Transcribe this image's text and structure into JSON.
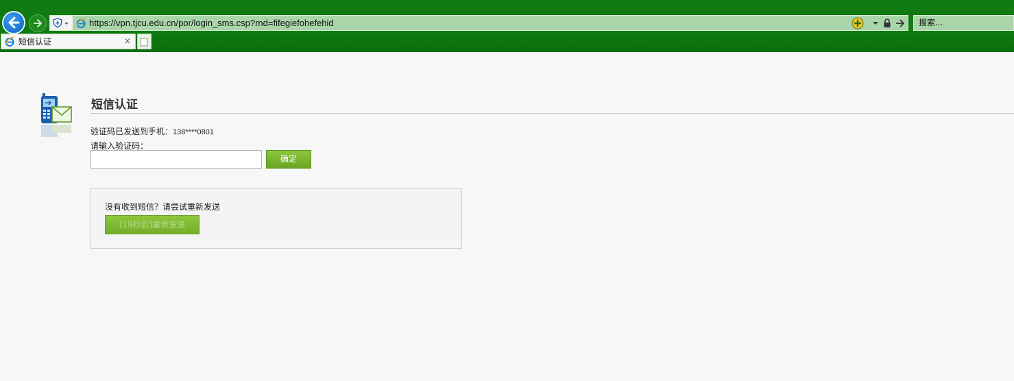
{
  "browser": {
    "url": "https://vpn.tjcu.edu.cn/por/login_sms.csp?rnd=fifegiefohefehid",
    "search_placeholder": "搜索...",
    "tab_title": "短信认证",
    "tab_close": "×"
  },
  "page": {
    "title": "短信认证",
    "sent_label": "验证码已发送到手机：",
    "sent_phone": "138****0801",
    "input_label": "请输入验证码：",
    "input_value": "",
    "confirm_label": "确定",
    "resend_prompt": "没有收到短信？请尝试重新发送",
    "resend_label": "(19秒后)重新发送"
  },
  "colors": {
    "chrome_green": "#0f7b0f",
    "button_green": "#7db630",
    "back_blue": "#0a62c0"
  }
}
